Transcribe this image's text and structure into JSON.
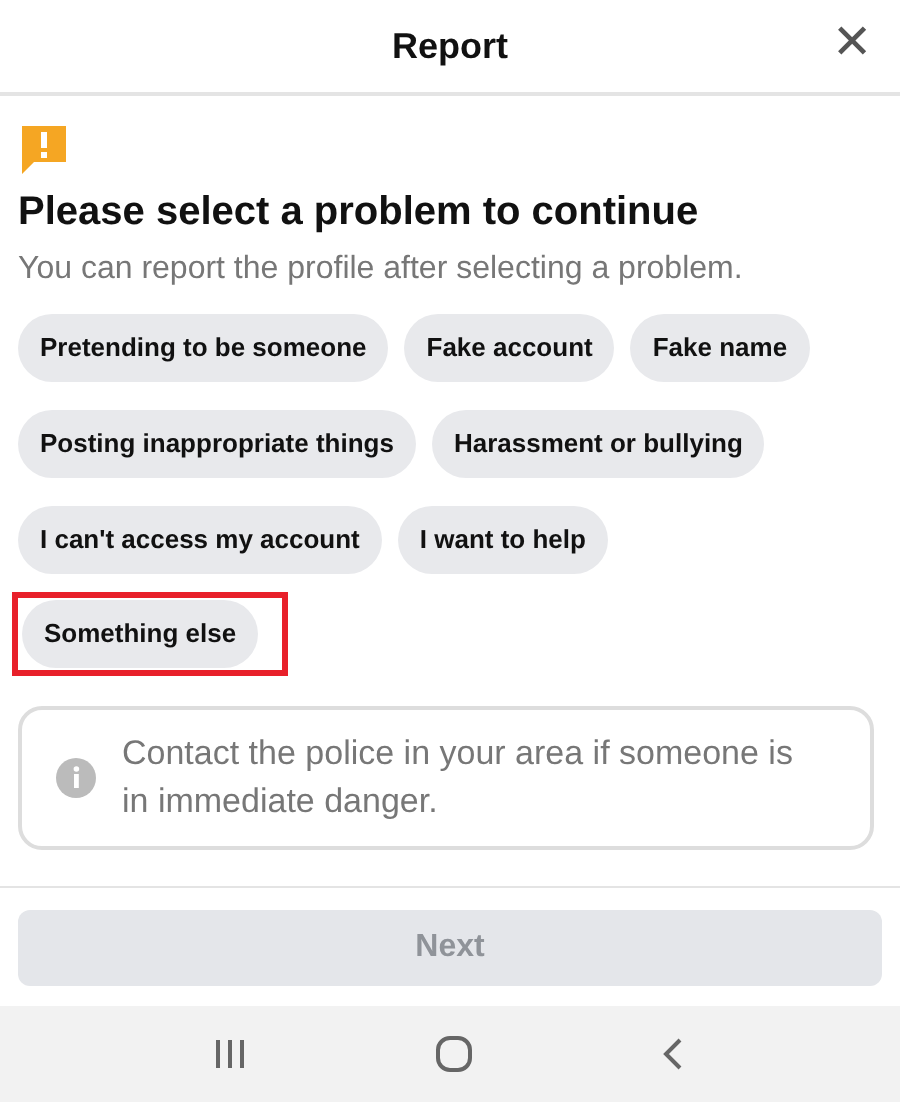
{
  "header": {
    "title": "Report",
    "close": "✕"
  },
  "prompt": {
    "title": "Please select a problem to continue",
    "subtitle": "You can report the profile after selecting a problem."
  },
  "options": [
    {
      "label": "Pretending to be someone",
      "highlighted": false
    },
    {
      "label": "Fake account",
      "highlighted": false
    },
    {
      "label": "Fake name",
      "highlighted": false
    },
    {
      "label": "Posting inappropriate things",
      "highlighted": false
    },
    {
      "label": "Harassment or bullying",
      "highlighted": false
    },
    {
      "label": "I can't access my account",
      "highlighted": false
    },
    {
      "label": "I want to help",
      "highlighted": false
    },
    {
      "label": "Something else",
      "highlighted": true
    }
  ],
  "notice": "Contact the police in your area if someone is in immediate danger.",
  "next_button": {
    "label": "Next",
    "disabled": true
  }
}
